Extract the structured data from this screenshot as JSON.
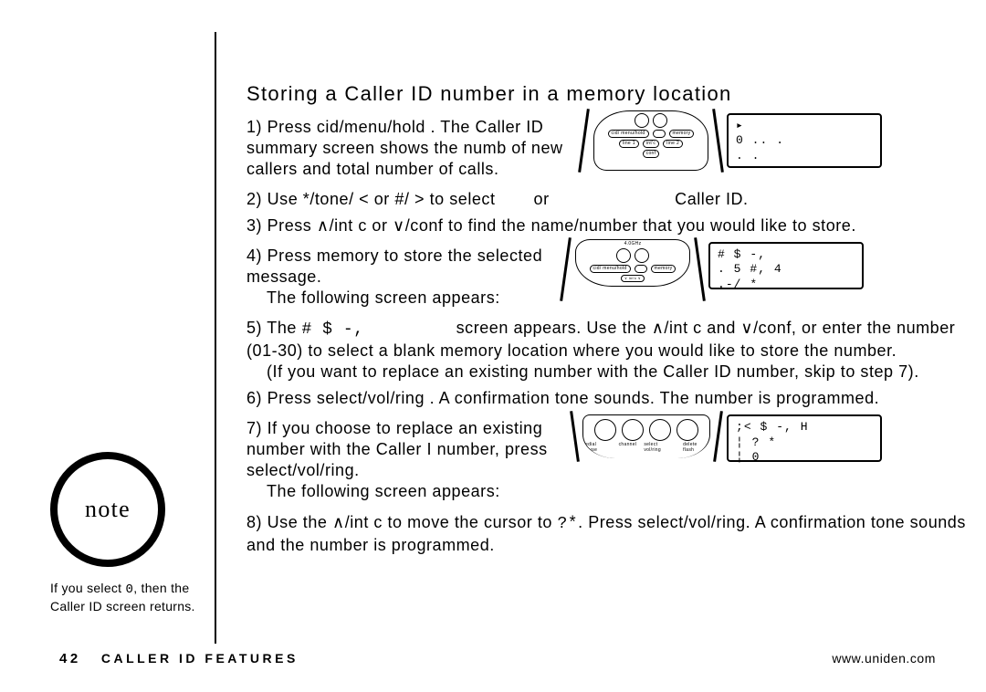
{
  "title": "Storing a Caller ID number in a memory location",
  "steps": {
    "s1a": "1) Press",
    "s1b": "cid/menu/hold",
    "s1c": ". The Caller ID summary screen shows the numb of new callers and total number of calls.",
    "s2a": "2) Use ",
    "s2b": "*/tone/ <",
    "s2c": " or ",
    "s2d": "#/ >",
    "s2e": " to select",
    "s2f": "or",
    "s2g": "Caller ID.",
    "s3a": "3) Press ",
    "s3b": "∧/int c",
    "s3c": " or ",
    "s3d": "∨/conf",
    "s3e": " to find the name/number that you would like to store.",
    "s4a": "4) Press",
    "s4b": "memory",
    "s4c": " to store the selected message.",
    "s4d": "The following screen appears:",
    "s5a": "5) The ",
    "s5b": "# $ -,",
    "s5c": " screen appears. Use the ",
    "s5d": "∧/int c",
    "s5e": " and ",
    "s5f": "∨/conf",
    "s5g": ", or enter the number (01-30) to select a blank memory location where you would like to store the number.",
    "s5h": "(If you want to replace an existing number with the Caller ID number, skip to step 7).",
    "s6a": "6) Press",
    "s6b": "select/vol/ring",
    "s6c": ". A confirmation tone sounds. The number is programmed.",
    "s7a": "7) If you choose to replace an existing number with the Caller I number, press",
    "s7b": "select/vol/ring",
    "s7c": ".",
    "s7d": "The following screen appears:",
    "s8a": "8) Use the ",
    "s8b": "∧/int c",
    "s8c": " to move the cursor to ",
    "s8d": "?*",
    "s8e": ". Press",
    "s8f": "select/vol/ring",
    "s8g": ". A confirmation tone sounds and the number is programmed."
  },
  "lcd1": {
    "l1": "▸",
    "l2": "0 .. .",
    "l3": " .  ."
  },
  "lcd2": {
    "l1": "# $ -,",
    "l2": ". 5  #, 4",
    "l3": ".-/ *"
  },
  "lcd3": {
    "l1": ";< $ -, H",
    "l2": "¦ ? *",
    "l3": "¦ 0"
  },
  "phone_labels": {
    "topL": "cid/\nmenu/hold",
    "topR": "memory",
    "line1": "line 1",
    "line2": "line 2",
    "intc": "int'c",
    "conf": "conf"
  },
  "phone2_labels": {
    "a": "redial\npause",
    "b": "channel",
    "c": "select\nvol/ring",
    "d": "delete\nflash"
  },
  "note": {
    "label": "note",
    "text_a": "If you select ",
    "text_b": "0",
    "text_c": ", then the Caller ID screen returns."
  },
  "footer": {
    "page": "42",
    "section": "CALLER ID FEATURES",
    "url": "www.uniden.com"
  }
}
